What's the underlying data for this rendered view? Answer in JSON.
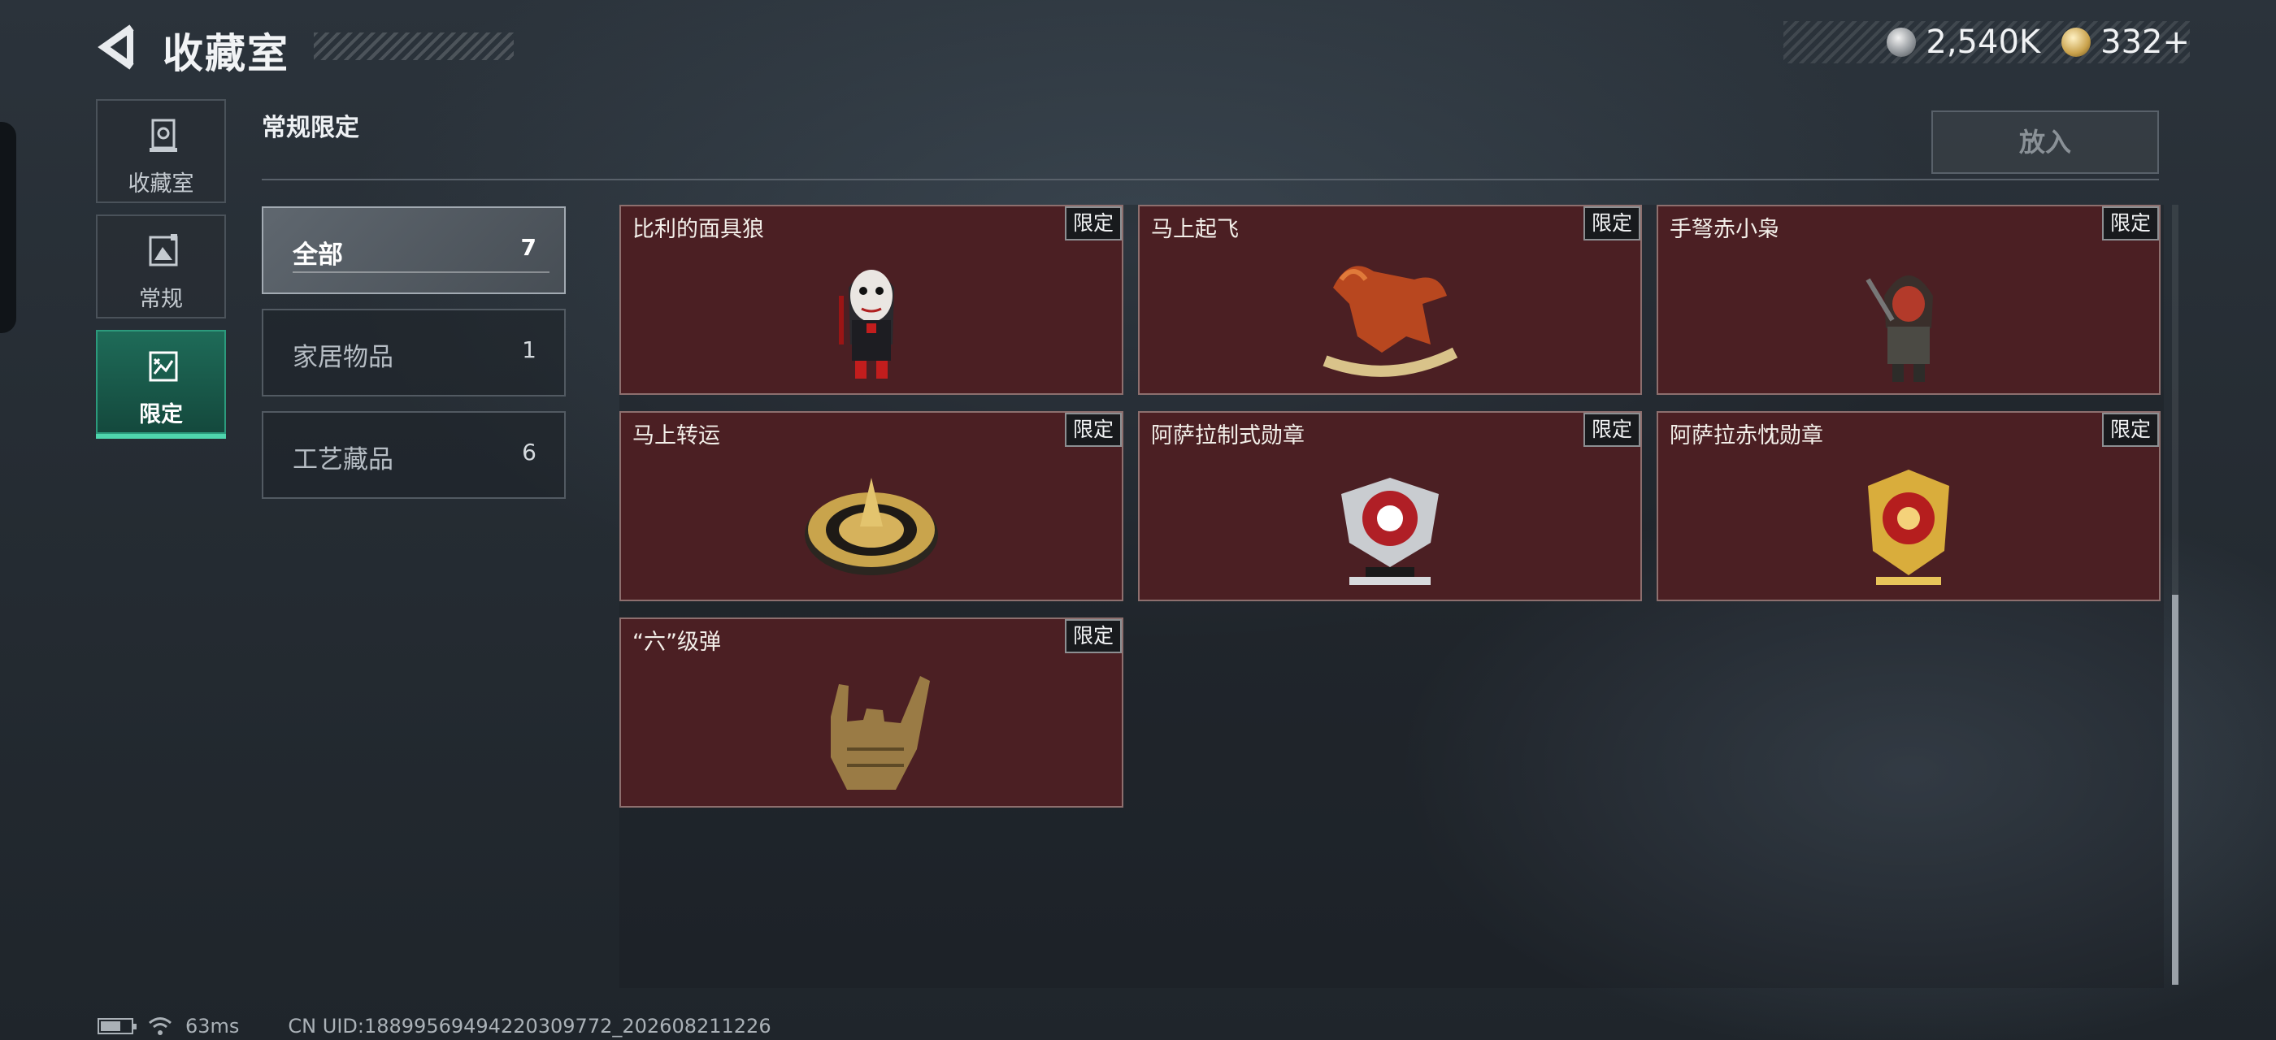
{
  "header": {
    "title": "收藏室",
    "currencies": [
      {
        "icon": "silver-coin-icon",
        "value": "2,540K"
      },
      {
        "icon": "gold-coin-icon",
        "value": "332+"
      }
    ]
  },
  "sidebar": {
    "items": [
      {
        "label": "收藏室",
        "icon": "trophy-case-icon",
        "active": false
      },
      {
        "label": "常规",
        "icon": "picture-frame-icon",
        "active": false
      },
      {
        "label": "限定",
        "icon": "limited-image-icon",
        "active": true
      }
    ]
  },
  "section": {
    "title": "常规限定",
    "place_button": "放入"
  },
  "filters": [
    {
      "label": "全部",
      "count": "7",
      "active": true
    },
    {
      "label": "家居物品",
      "count": "1",
      "active": false
    },
    {
      "label": "工艺藏品",
      "count": "6",
      "active": false
    }
  ],
  "items": [
    {
      "name": "比利的面具狼",
      "badge": "限定",
      "art": "puppet-figure-icon"
    },
    {
      "name": "马上起飞",
      "badge": "限定",
      "art": "rocking-horse-icon"
    },
    {
      "name": "手弩赤小枭",
      "badge": "限定",
      "art": "hooded-figure-icon"
    },
    {
      "name": "马上转运",
      "badge": "限定",
      "art": "golden-wheel-icon"
    },
    {
      "name": "阿萨拉制式勋章",
      "badge": "限定",
      "art": "silver-medal-icon"
    },
    {
      "name": "阿萨拉赤忱勋章",
      "badge": "限定",
      "art": "gold-medal-icon"
    },
    {
      "name": "“六”级弹",
      "badge": "限定",
      "art": "hand-sign-icon"
    }
  ],
  "status": {
    "ping": "63ms",
    "uid": "CN UID:18899569494220309772_202608211226"
  },
  "colors": {
    "accent": "#2c9a7c",
    "card_bg": "#4b1f23",
    "badge_bg": "#181a1d"
  }
}
